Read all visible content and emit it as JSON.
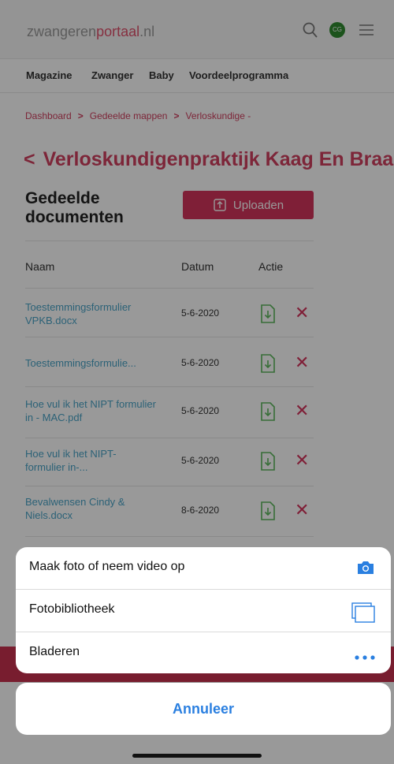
{
  "header": {
    "logo_prefix": "zwangeren",
    "logo_brand": "portaal",
    "logo_suffix": ".nl",
    "avatar_initials": "CG",
    "icons": [
      "search-icon",
      "avatar",
      "menu-icon"
    ]
  },
  "nav": {
    "items": [
      "Magazine",
      "Zwanger",
      "Baby",
      "Voordeelprogramma"
    ]
  },
  "breadcrumb": {
    "items": [
      "Dashboard",
      "Gedeelde mappen",
      "Verloskundige -"
    ]
  },
  "page": {
    "title": "Verloskundigenpraktijk Kaag En Braassem"
  },
  "documents": {
    "section_title": "Gedeelde documenten",
    "upload_label": "Uploaden",
    "columns": [
      "Naam",
      "Datum",
      "Actie"
    ],
    "rows": [
      {
        "name": "Toestemmingsformulier VPKB.docx",
        "date": "5-6-2020"
      },
      {
        "name": "Toestemmingsformulie...",
        "date": "5-6-2020"
      },
      {
        "name": "Hoe vul ik het NIPT formulier in - MAC.pdf",
        "date": "5-6-2020"
      },
      {
        "name": "Hoe vul ik het NIPT-formulier in-...",
        "date": "5-6-2020"
      },
      {
        "name": "Bevalwensen Cindy & Niels.docx",
        "date": "8-6-2020"
      }
    ]
  },
  "action_sheet": {
    "options": [
      {
        "label": "Maak foto of neem video op",
        "icon": "camera-icon"
      },
      {
        "label": "Fotobibliotheek",
        "icon": "photo-library-icon"
      },
      {
        "label": "Bladeren",
        "icon": "more-icon"
      }
    ],
    "cancel_label": "Annuleer"
  },
  "colors": {
    "brand": "#d4355d",
    "link": "#4aa3c7",
    "ios_blue": "#2a7fe0",
    "download_green": "#5cb85c"
  }
}
